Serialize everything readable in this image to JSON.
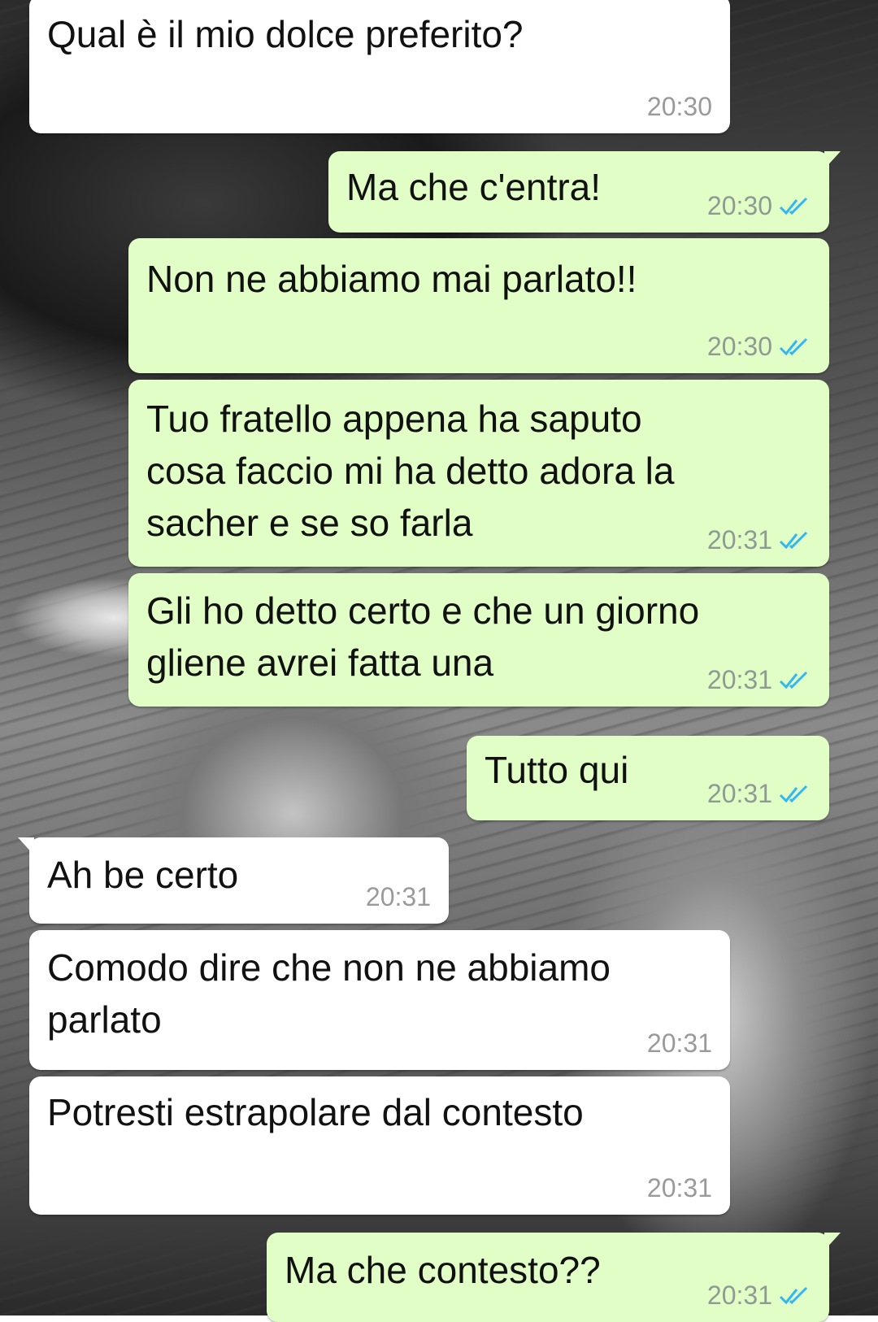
{
  "chat": {
    "messages": [
      {
        "direction": "incoming",
        "text": "Qual è il mio dolce preferito?",
        "time": "20:30"
      },
      {
        "direction": "outgoing",
        "text": "Ma che c'entra!",
        "time": "20:30",
        "status": "read-double-check-icon"
      },
      {
        "direction": "outgoing",
        "text": "Non ne abbiamo mai parlato!!",
        "time": "20:30",
        "status": "read-double-check-icon"
      },
      {
        "direction": "outgoing",
        "text": "Tuo fratello appena ha saputo\ncosa faccio mi ha detto adora la\nsacher e se so farla",
        "time": "20:31",
        "status": "read-double-check-icon"
      },
      {
        "direction": "outgoing",
        "text": "Gli ho detto certo e che un giorno\ngliene avrei fatta una",
        "time": "20:31",
        "status": "read-double-check-icon"
      },
      {
        "direction": "outgoing",
        "text": "Tutto qui",
        "time": "20:31",
        "status": "read-double-check-icon"
      },
      {
        "direction": "incoming",
        "text": "Ah be certo",
        "time": "20:31"
      },
      {
        "direction": "incoming",
        "text": "Comodo dire che non ne abbiamo\nparlato",
        "time": "20:31"
      },
      {
        "direction": "incoming",
        "text": "Potresti estrapolare dal contesto",
        "time": "20:31"
      },
      {
        "direction": "outgoing",
        "text": "Ma che contesto??",
        "time": "20:31",
        "status": "read-double-check-icon"
      }
    ]
  },
  "colors": {
    "incoming_bubble": "#ffffff",
    "outgoing_bubble": "#e1fec7",
    "read_tick": "#34b7f1"
  }
}
